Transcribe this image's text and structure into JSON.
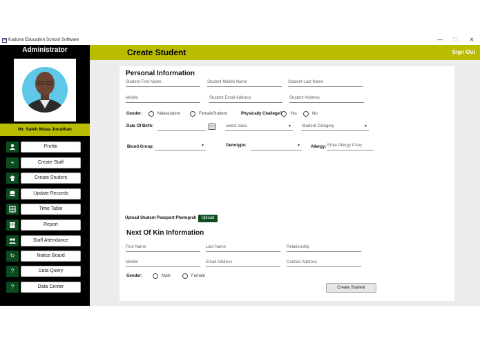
{
  "window": {
    "title": "Kaduna Education School Software",
    "controls": {
      "minimize": "—",
      "maximize": "☐",
      "close": "✕"
    }
  },
  "sidebar": {
    "role": "Administrator",
    "user_name": "Mr.  Saleh Musa Jonathan",
    "items": [
      {
        "label": "Profile",
        "icon": "person-icon",
        "glyph": "👤"
      },
      {
        "label": "Create Staff",
        "icon": "plus-icon",
        "glyph": "+"
      },
      {
        "label": "Create Student",
        "icon": "student-icon",
        "glyph": "☗"
      },
      {
        "label": "Update Records",
        "icon": "database-icon",
        "glyph": "≋"
      },
      {
        "label": "Time Table",
        "icon": "table-icon",
        "glyph": "▦"
      },
      {
        "label": "Report",
        "icon": "archive-icon",
        "glyph": "▤"
      },
      {
        "label": "Staff Attendance",
        "icon": "users-icon",
        "glyph": "👥"
      },
      {
        "label": "Notice Board",
        "icon": "refresh-icon",
        "glyph": "↻"
      },
      {
        "label": "Data Query",
        "icon": "question-icon",
        "glyph": "?"
      },
      {
        "label": "Data Center",
        "icon": "question-icon",
        "glyph": "?"
      }
    ]
  },
  "header": {
    "title": "Create Student",
    "sign_out": "Sign Out"
  },
  "personal": {
    "heading": "Personal Information",
    "first_name": "Student First Name",
    "middle_name": "Student Middle Name",
    "last_name": "Student Last Name",
    "mobile": "Mobile",
    "email": "Student Email Address",
    "address": "Student Address",
    "gender_label": "Gender:",
    "gender_male": "Malestudent",
    "gender_female": "FemaleStudent",
    "challenged_label": "Physically Challege?",
    "yes": "Yes",
    "no": "No",
    "dob_label": "Date Of Birth:",
    "class_placeholder": "select class",
    "category_placeholder": "Student Category",
    "blood_label": "Blood Group:",
    "genotype_label": "Genotype:",
    "allergy_label": "Allergy:",
    "allergy_placeholder": "Enter Allergy if Any",
    "upload_label": "Upload Student Passport Photograh",
    "upload_button": "Upload"
  },
  "kin": {
    "heading": "Next Of Kin Information",
    "first_name": "First Name",
    "last_name": "Last Name",
    "relationship": "Relationship",
    "mobile": "Mobile",
    "email": "Email Address",
    "address": "Contact Address",
    "gender_label": "Gender:",
    "male": "Male",
    "female": "Female"
  },
  "actions": {
    "create": "Create Student"
  },
  "colors": {
    "accent": "#b9bc00",
    "nav_icon_bg": "#0b4d1f",
    "sidebar_bg": "#000000"
  }
}
